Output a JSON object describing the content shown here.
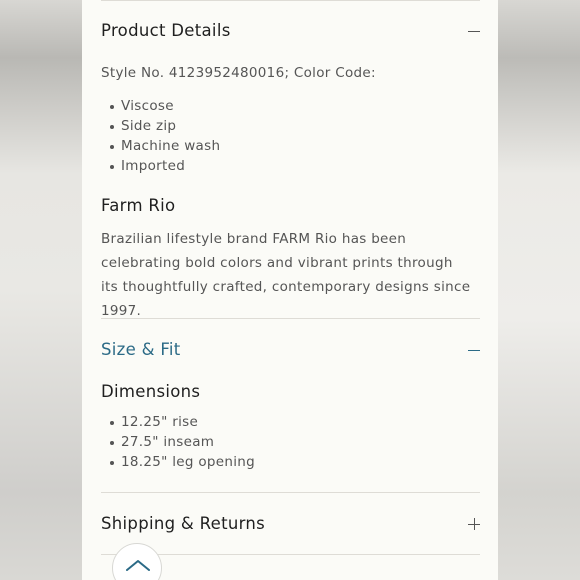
{
  "product_details": {
    "title": "Product Details",
    "style_line": "Style No. 4123952480016; Color Code:",
    "bullets": [
      "Viscose",
      "Side zip",
      "Machine wash",
      "Imported"
    ]
  },
  "brand": {
    "name": "Farm Rio",
    "description": "Brazilian lifestyle brand FARM Rio has been celebrating bold colors and vibrant prints through its thoughtfully crafted, contemporary designs since 1997."
  },
  "size_fit": {
    "title": "Size & Fit",
    "dimensions_heading": "Dimensions",
    "bullets": [
      "12.25\" rise",
      "27.5\" inseam",
      "18.25\" leg opening"
    ]
  },
  "shipping": {
    "title": "Shipping & Returns"
  },
  "colors": {
    "accent": "#2b6a86",
    "text": "#1f1f1f",
    "muted": "#555555",
    "page_bg": "#fbfbf7"
  }
}
